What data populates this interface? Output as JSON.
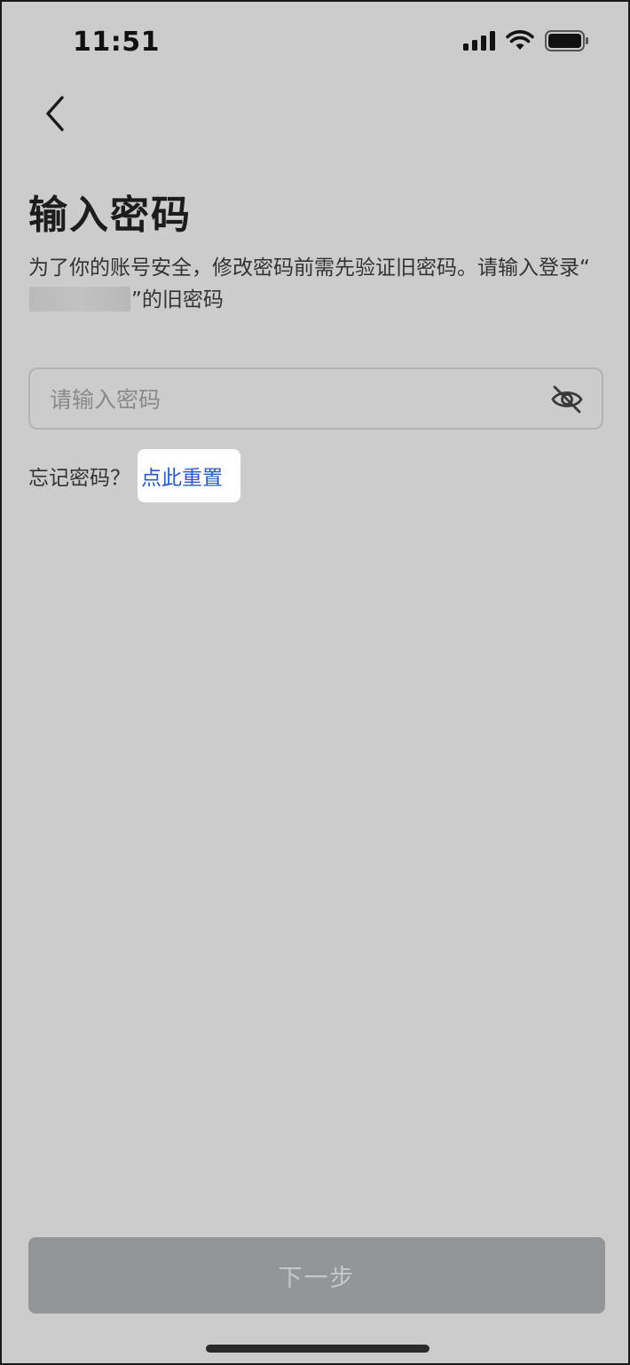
{
  "status_bar": {
    "time": "11:51"
  },
  "header": {
    "title": "输入密码"
  },
  "description": {
    "prefix": "为了你的账号安全，修改密码前需先验证旧密码。请输入登录“",
    "suffix": "”的旧密码"
  },
  "password": {
    "placeholder": "请输入密码",
    "value": ""
  },
  "forgot": {
    "text": "忘记密码？",
    "link": "点此重置"
  },
  "footer": {
    "next_label": "下一步"
  },
  "colors": {
    "background": "#cccccc",
    "link": "#2b59c3",
    "button_disabled": "#939597"
  }
}
